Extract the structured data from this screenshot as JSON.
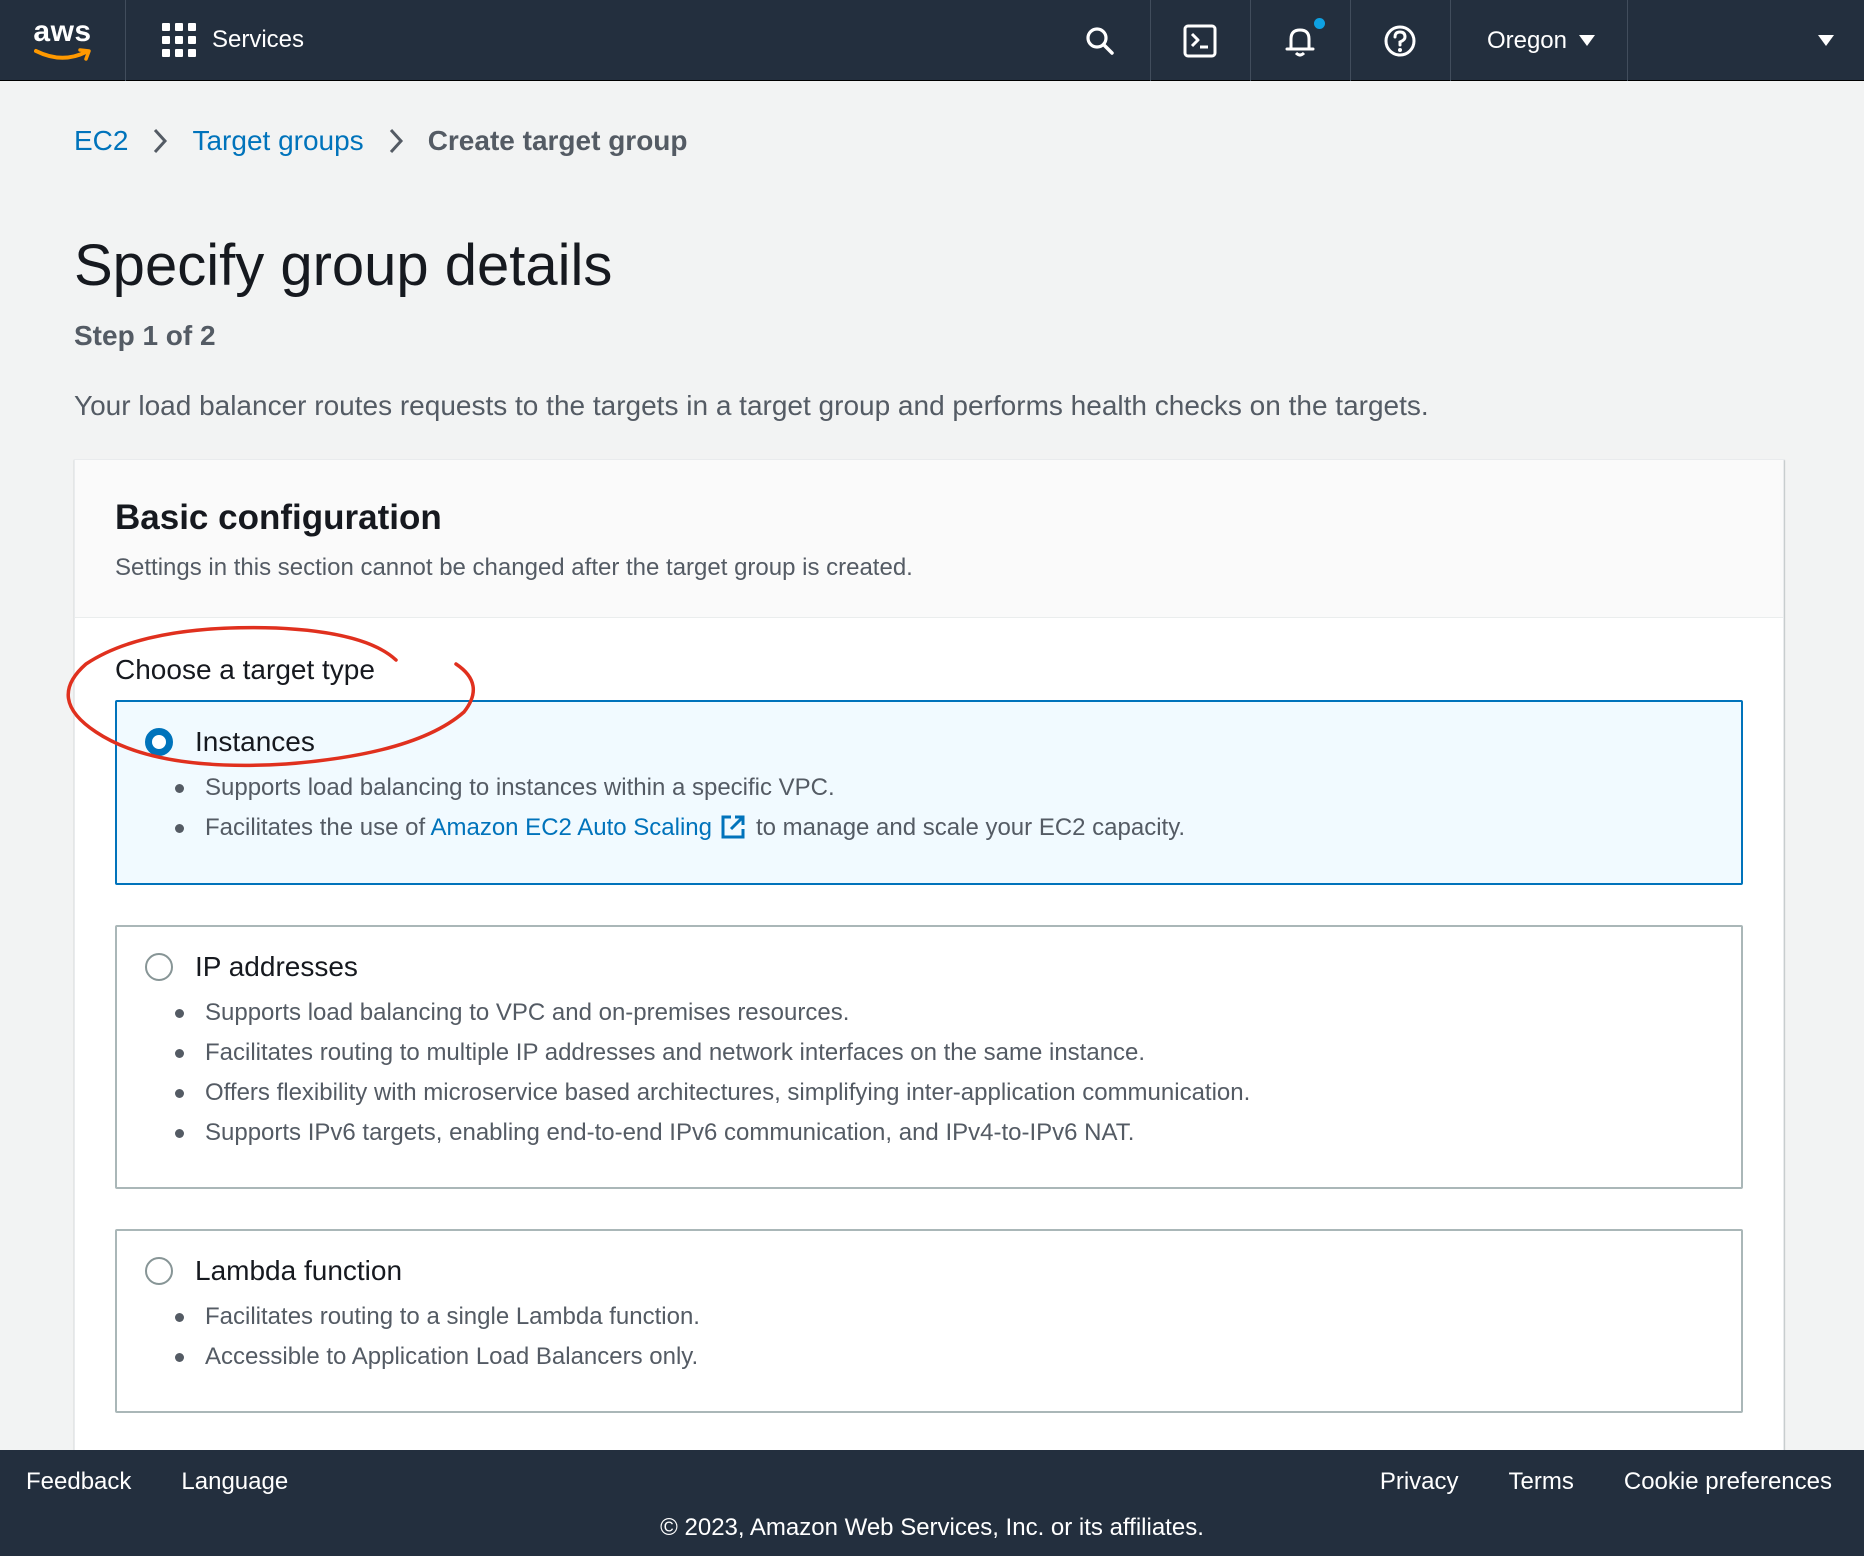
{
  "nav": {
    "logo_text": "aws",
    "services_label": "Services",
    "icons": [
      "search-icon",
      "cloudshell-icon",
      "bell-icon",
      "help-icon"
    ],
    "region": "Oregon"
  },
  "breadcrumb": {
    "items": [
      "EC2",
      "Target groups"
    ],
    "current": "Create target group"
  },
  "page": {
    "title": "Specify group details",
    "step": "Step 1 of 2",
    "description": "Your load balancer routes requests to the targets in a target group and performs health checks on the targets."
  },
  "basic_config": {
    "title": "Basic configuration",
    "subtitle": "Settings in this section cannot be changed after the target group is created.",
    "choose_label": "Choose a target type",
    "options": [
      {
        "label": "Instances",
        "selected": true,
        "bullets": [
          "Supports load balancing to instances within a specific VPC.",
          "Facilitates the use of "
        ],
        "link": "Amazon EC2 Auto Scaling",
        "after_link": "to manage and scale your EC2 capacity."
      },
      {
        "label": "IP addresses",
        "selected": false,
        "bullets": [
          "Supports load balancing to VPC and on-premises resources.",
          "Facilitates routing to multiple IP addresses and network interfaces on the same instance.",
          "Offers flexibility with microservice based architectures, simplifying inter-application communication.",
          "Supports IPv6 targets, enabling end-to-end IPv6 communication, and IPv4-to-IPv6 NAT."
        ]
      },
      {
        "label": "Lambda function",
        "selected": false,
        "bullets": [
          "Facilitates routing to a single Lambda function.",
          "Accessible to Application Load Balancers only."
        ]
      }
    ]
  },
  "footer": {
    "left": [
      "Feedback",
      "Language"
    ],
    "right": [
      "Privacy",
      "Terms",
      "Cookie preferences"
    ],
    "copyright": "© 2023, Amazon Web Services, Inc. or its affiliates."
  },
  "colors": {
    "nav_bg": "#232f3e",
    "link": "#0073bb",
    "selected_bg": "#f1faff",
    "annotation": "#e0301e"
  }
}
